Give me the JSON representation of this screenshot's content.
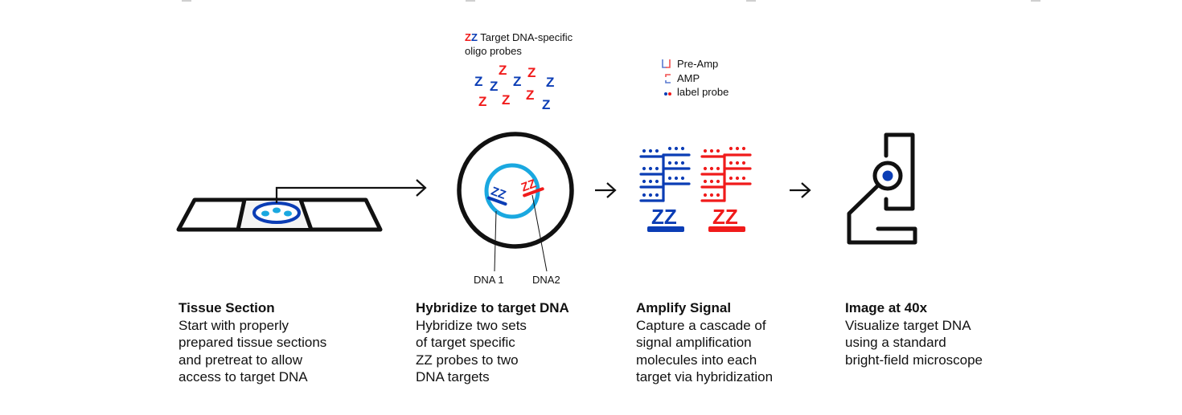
{
  "colors": {
    "blue": "#0b3db5",
    "red": "#f01b1b",
    "cyan": "#1aa8e0",
    "black": "#111111"
  },
  "probe_legend": {
    "glyph": "ZZ",
    "line1": "Target DNA-specific",
    "line2": "oligo probes"
  },
  "amp_legend": [
    {
      "icon": "pre-amp-icon",
      "label": "Pre-Amp"
    },
    {
      "icon": "amp-icon",
      "label": "AMP"
    },
    {
      "icon": "label-probe-icon",
      "label": "label probe"
    }
  ],
  "dna_labels": {
    "dna1": "DNA 1",
    "dna2": "DNA2"
  },
  "probe_glyph": "Z",
  "zz_glyph": "ZZ",
  "steps": [
    {
      "title": "Tissue Section",
      "lines": [
        "Start with properly",
        "prepared tissue sections",
        "and pretreat to allow",
        "access to target DNA"
      ]
    },
    {
      "title": "Hybridize to target DNA",
      "lines": [
        "Hybridize two sets",
        "of target specific",
        "ZZ probes to two",
        "DNA targets"
      ]
    },
    {
      "title": "Amplify Signal",
      "lines": [
        "Capture a cascade of",
        "signal amplification",
        "molecules into each",
        "target via hybridization"
      ]
    },
    {
      "title": "Image at 40x",
      "lines": [
        "Visualize target DNA",
        "using a standard",
        "bright-field microscope"
      ]
    }
  ]
}
